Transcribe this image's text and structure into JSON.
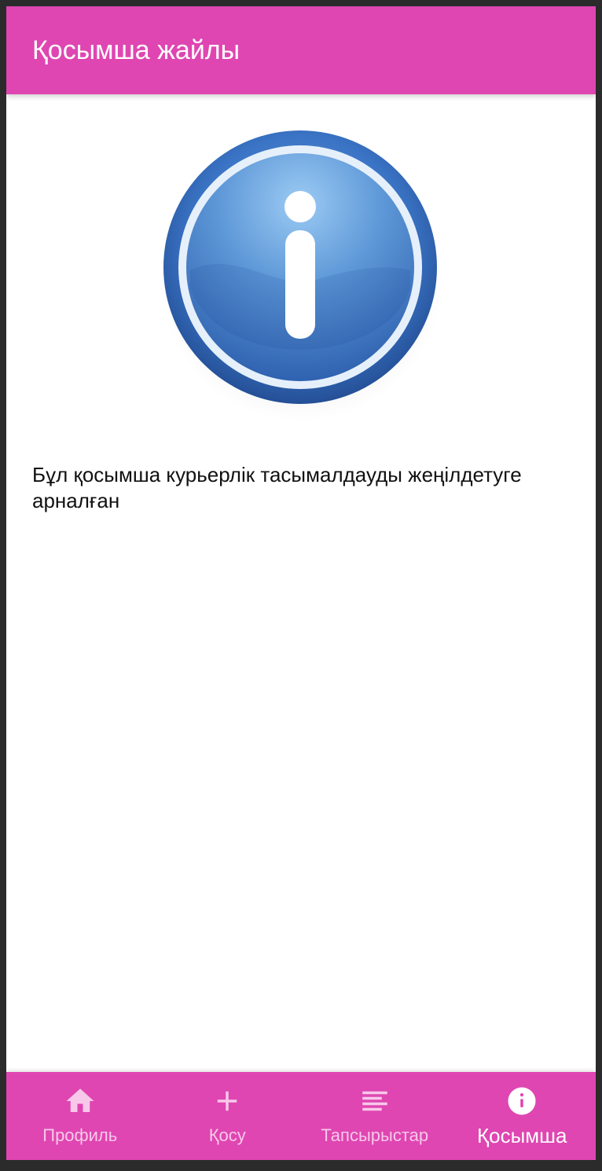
{
  "app_bar": {
    "title": "Қосымша жайлы"
  },
  "main": {
    "image_icon": "info-icon",
    "description": "Бұл қосымша курьерлік тасымалдауды жеңілдетуге арналған"
  },
  "bottom_nav": {
    "items": [
      {
        "label": "Профиль",
        "icon": "home-icon",
        "active": false
      },
      {
        "label": "Қосу",
        "icon": "plus-icon",
        "active": false
      },
      {
        "label": "Тапсырыстар",
        "icon": "list-icon",
        "active": false
      },
      {
        "label": "Қосымша",
        "icon": "info-icon",
        "active": true
      }
    ]
  },
  "colors": {
    "primary": "#df46b1",
    "inactive_nav": "#f8c8ea",
    "active_nav": "#ffffff",
    "info_blue": "#3a75c4"
  }
}
